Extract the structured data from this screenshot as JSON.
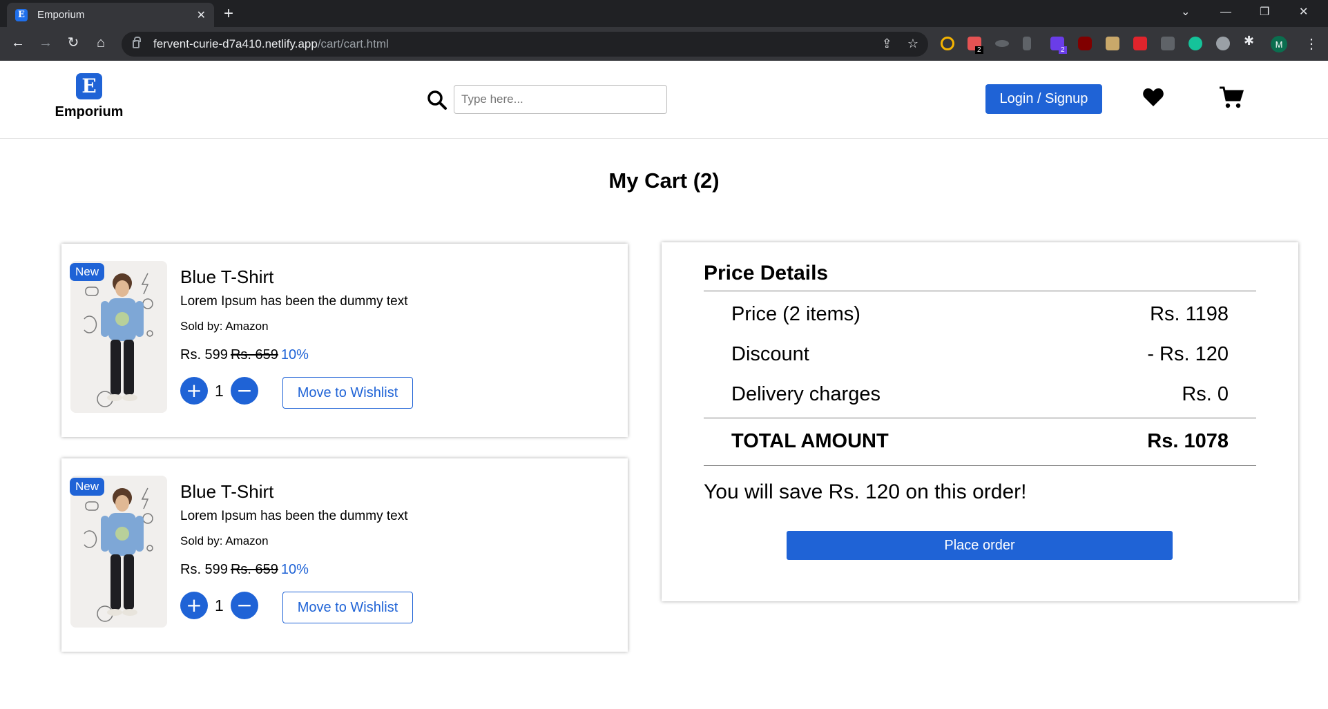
{
  "browser": {
    "tab_title": "Emporium",
    "url_host": "fervent-curie-d7a410.netlify.app",
    "url_path": "/cart/cart.html",
    "profile_initial": "M",
    "extension_badges": [
      "2",
      "2"
    ]
  },
  "header": {
    "logo_letter": "E",
    "brand_name": "Emporium",
    "search_placeholder": "Type here...",
    "login_label": "Login / Signup"
  },
  "cart": {
    "title": "My Cart (2)",
    "items": [
      {
        "badge": "New",
        "name": "Blue T-Shirt",
        "description": "Lorem Ipsum has been the dummy text",
        "seller": "Sold by: Amazon",
        "price": "Rs. 599",
        "mrp": "Rs. 659",
        "discount": "10%",
        "quantity": "1",
        "plus_label": "+",
        "minus_label": "−",
        "wishlist_label": "Move to Wishlist"
      },
      {
        "badge": "New",
        "name": "Blue T-Shirt",
        "description": "Lorem Ipsum has been the dummy text",
        "seller": "Sold by: Amazon",
        "price": "Rs. 599",
        "mrp": "Rs. 659",
        "discount": "10%",
        "quantity": "1",
        "plus_label": "+",
        "minus_label": "−",
        "wishlist_label": "Move to Wishlist"
      }
    ]
  },
  "price_details": {
    "title": "Price Details",
    "rows": [
      {
        "label": "Price (2 items)",
        "value": "Rs. 1198"
      },
      {
        "label": "Discount",
        "value": "- Rs. 120"
      },
      {
        "label": "Delivery charges",
        "value": "Rs. 0"
      }
    ],
    "total_label": "TOTAL AMOUNT",
    "total_value": "Rs. 1078",
    "savings_text": "You will save Rs. 120 on this order!",
    "place_order_label": "Place order"
  },
  "colors": {
    "accent": "#1f63d6",
    "chrome_dark": "#202124",
    "chrome_toolbar": "#35363a"
  },
  "icons": {
    "search": "search-icon",
    "wishlist": "heart-icon",
    "cart": "cart-icon"
  }
}
